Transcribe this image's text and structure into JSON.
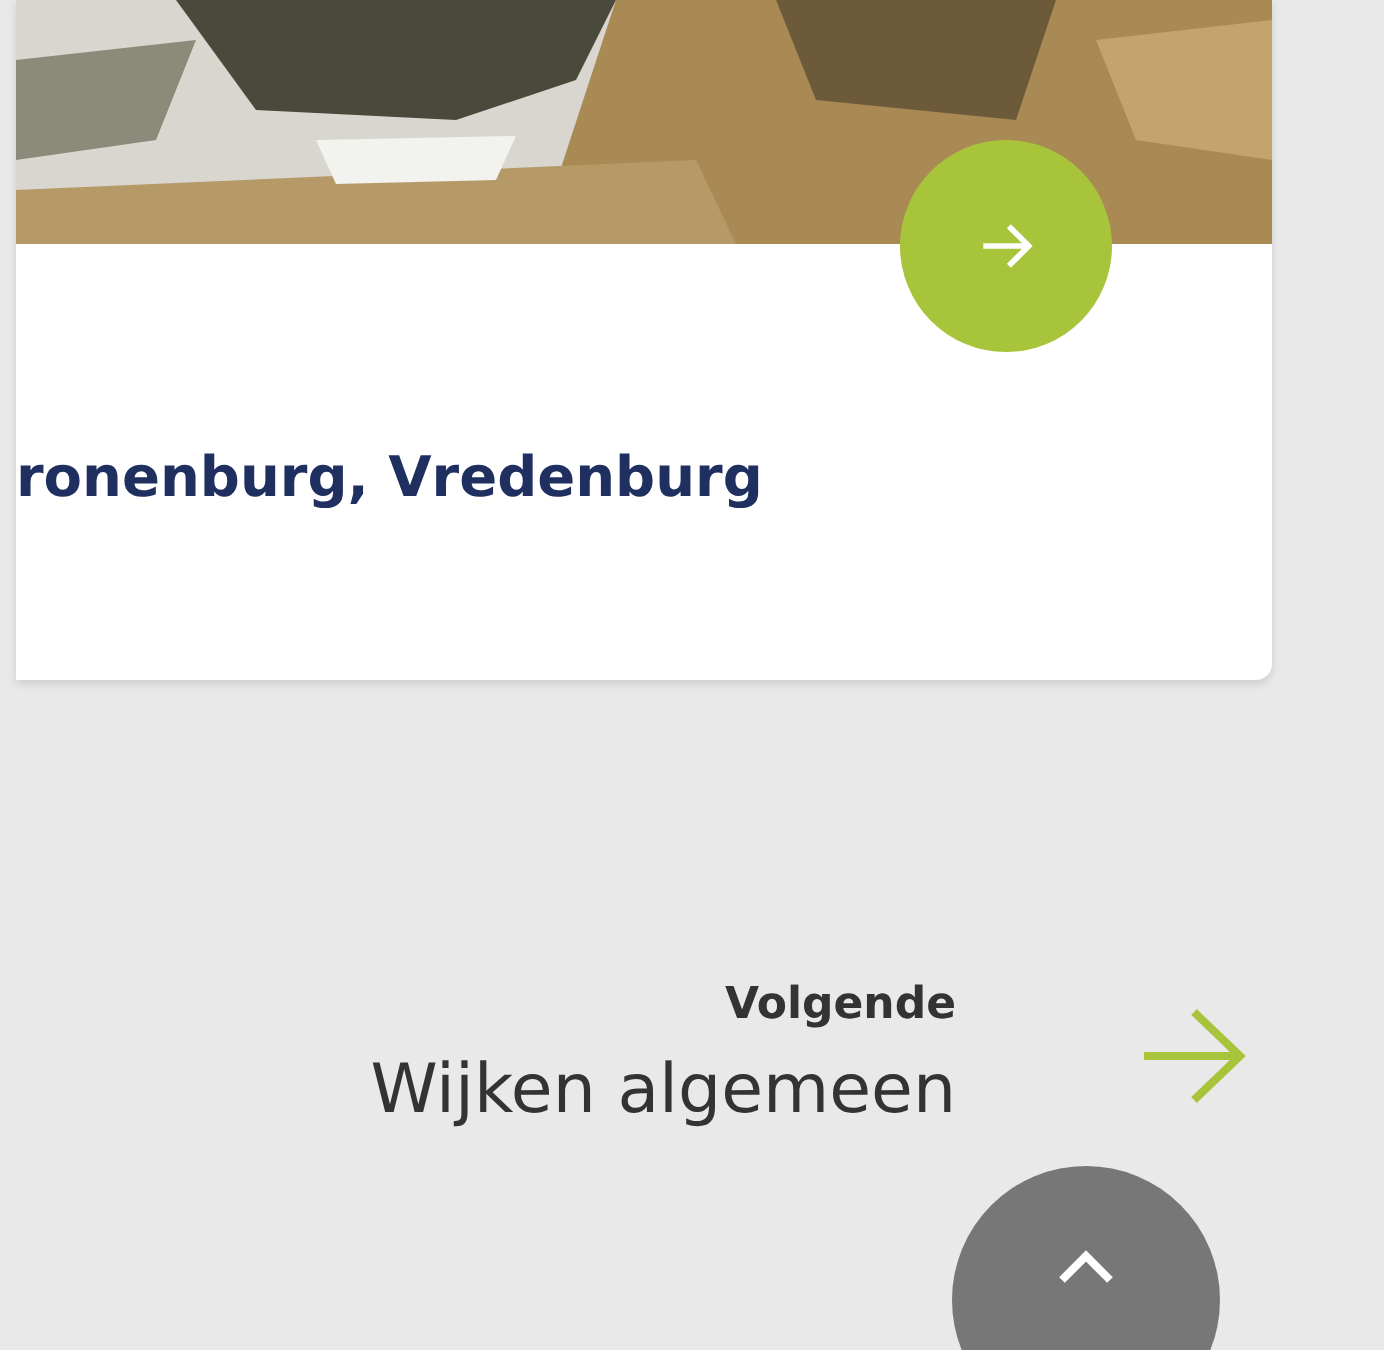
{
  "card": {
    "kind": "picture",
    "title": "ronenburg, Vredenburg"
  },
  "next": {
    "label": "Volgende",
    "title": "Wijken algemeen"
  }
}
